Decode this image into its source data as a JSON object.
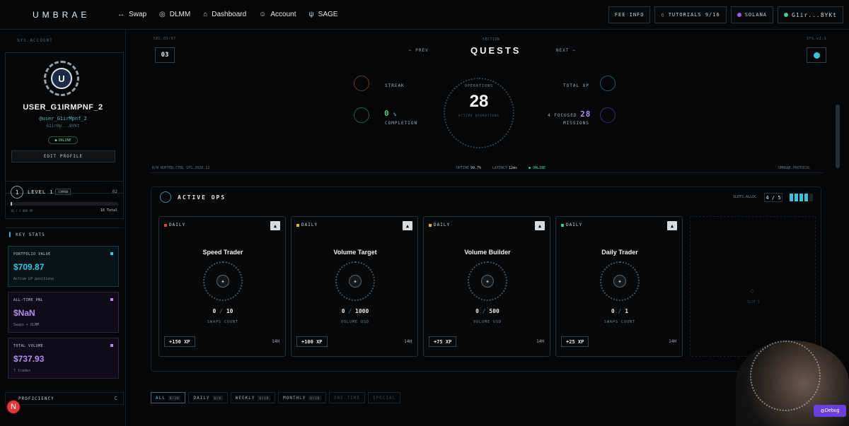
{
  "nav": {
    "logo": "UMBRAE",
    "items": [
      {
        "label": "Swap",
        "icon": "swap-arrows-icon",
        "glyph": "↔"
      },
      {
        "label": "DLMM",
        "icon": "dlmm-icon",
        "glyph": "◎"
      },
      {
        "label": "Dashboard",
        "icon": "home-icon",
        "glyph": "⌂"
      },
      {
        "label": "Account",
        "icon": "user-icon",
        "glyph": "☺"
      },
      {
        "label": "SAGE",
        "icon": "sage-icon",
        "glyph": "ψ"
      }
    ],
    "fee_info": "FEE INFO",
    "tutorials": "TUTORIALS 9/16",
    "network": "SOLANA",
    "wallet": "G1ir...8YKt"
  },
  "sidebar": {
    "section_label": "SYS.ACCOUNT",
    "avatar_letter": "U",
    "username": "USER_G1IRMPNF_2",
    "handle": "@user_G1irMpnf_2",
    "wallet_short": "G1irHp...8YKt",
    "online": "ONLINE",
    "edit_profile": "EDIT PROFILE",
    "level": {
      "number": "1",
      "title": "LEVEL 1",
      "badge": "COMMON",
      "right": "02",
      "xp_left": "16 / 1 000 XP",
      "xp_right": "16 Total",
      "xp_fraction": 0.016
    },
    "keystats_title": "KEY STATS",
    "stats": [
      {
        "label": "PORTFOLIO VALUE",
        "value": "$709.87",
        "sub": "Active LP positions",
        "color": "#36c6dd"
      },
      {
        "label": "ALL-TIME PNL",
        "value": "$NaN",
        "sub": "Swaps + DLMM",
        "color": "#b38cf0"
      },
      {
        "label": "TOTAL VOLUME",
        "value": "$737.93",
        "sub": "7 trades",
        "color": "#b38cf0"
      }
    ],
    "proficiency": "PROFICIENCY",
    "proficiency_right": "C",
    "notif_letter": "N"
  },
  "main": {
    "sec_code": "SEC.03/07",
    "section_code": "SECTION",
    "sys_code": "SYS.v2.1",
    "sec_number": "03",
    "title": "QUESTS",
    "prev": "PREV",
    "next": "NEXT",
    "hud": {
      "streak_label": "STREAK",
      "completion_value": "0",
      "completion_unit": "%",
      "completion_label": "COMPLETION",
      "operations_caption": "OPERATIONS",
      "operations_value": "28",
      "operations_sub": "ACTIVE OPERATIONS",
      "totalxp_label": "TOTAL XP",
      "missions_prefix": "4 FOCUSED",
      "missions_value": "28",
      "missions_label": "MISSIONS",
      "foot_left": "R/W BUFFER:CTRL   SYS.2026.12",
      "uptime_label": "UPTIME",
      "uptime_value": "99.7%",
      "latency_label": "LATENCY",
      "latency_value": "12ms",
      "status": "ONLINE",
      "foot_right": "UMBRAE.PROTOCOL"
    },
    "active_ops": {
      "title": "ACTIVE OPS",
      "slots_label": "SLOTS.ALLOC",
      "slots_value": "4 / 5",
      "cards": [
        {
          "freq": "DAILY",
          "name": "Speed Trader",
          "current": "0",
          "target": "10",
          "unit": "SWAPS COUNT",
          "xp": "+150 XP",
          "time": "14H",
          "sq": "#e0463a"
        },
        {
          "freq": "DAILY",
          "name": "Volume Target",
          "current": "0",
          "target": "1000",
          "unit": "VOLUME USD",
          "xp": "+100 XP",
          "time": "14H",
          "sq": "#e0b43a"
        },
        {
          "freq": "DAILY",
          "name": "Volume Builder",
          "current": "0",
          "target": "500",
          "unit": "VOLUME USD",
          "xp": "+75 XP",
          "time": "14H",
          "sq": "#e0b43a"
        },
        {
          "freq": "DAILY",
          "name": "Daily Trader",
          "current": "0",
          "target": "1",
          "unit": "SWAPS COUNT",
          "xp": "+25 XP",
          "time": "14H",
          "sq": "#3ad08a"
        }
      ],
      "empty_slot": "SLOT 5"
    },
    "filters": [
      {
        "label": "ALL",
        "count": "0/28"
      },
      {
        "label": "DAILY",
        "count": "0/8"
      },
      {
        "label": "WEEKLY",
        "count": "0/10"
      },
      {
        "label": "MONTHLY",
        "count": "0/10"
      },
      {
        "label": "ONE-TIME",
        "count": ""
      },
      {
        "label": "SPECIAL",
        "count": ""
      }
    ]
  },
  "debug": "Debug"
}
